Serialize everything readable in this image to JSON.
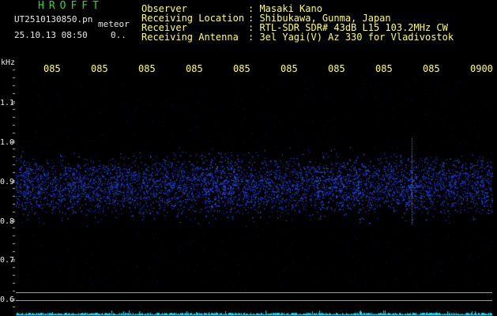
{
  "header": {
    "brand": "HROFFT",
    "filename": "UT2510130850.pn",
    "tag": "meteor",
    "datetime": "25.10.13 08:50",
    "count": "0.."
  },
  "info": [
    {
      "label": "Observer",
      "value": ": Masaki Kano"
    },
    {
      "label": "Receiving Location",
      "value": ": Shibukawa, Gunma, Japan"
    },
    {
      "label": "Receiver",
      "value": ": RTL-SDR SDR# 43dB L15 103.2MHz CW"
    },
    {
      "label": "Receiving Antenna",
      "value": ": 3el Yagi(V) Az 330 for Vladivostok"
    }
  ],
  "time_axis": [
    "085",
    "085",
    "085",
    "085",
    "085",
    "085",
    "085",
    "085",
    "085",
    "0900"
  ],
  "freq_axis": {
    "unit": "kHz",
    "ticks": [
      "1.1",
      "1.0",
      "0.9",
      "0.8",
      "0.7",
      "0.6"
    ]
  },
  "colors": {
    "signal": "#2a3cff",
    "spectrum": "#00e5ff",
    "text_info": "#ffff66",
    "brand": "#19e619"
  }
}
